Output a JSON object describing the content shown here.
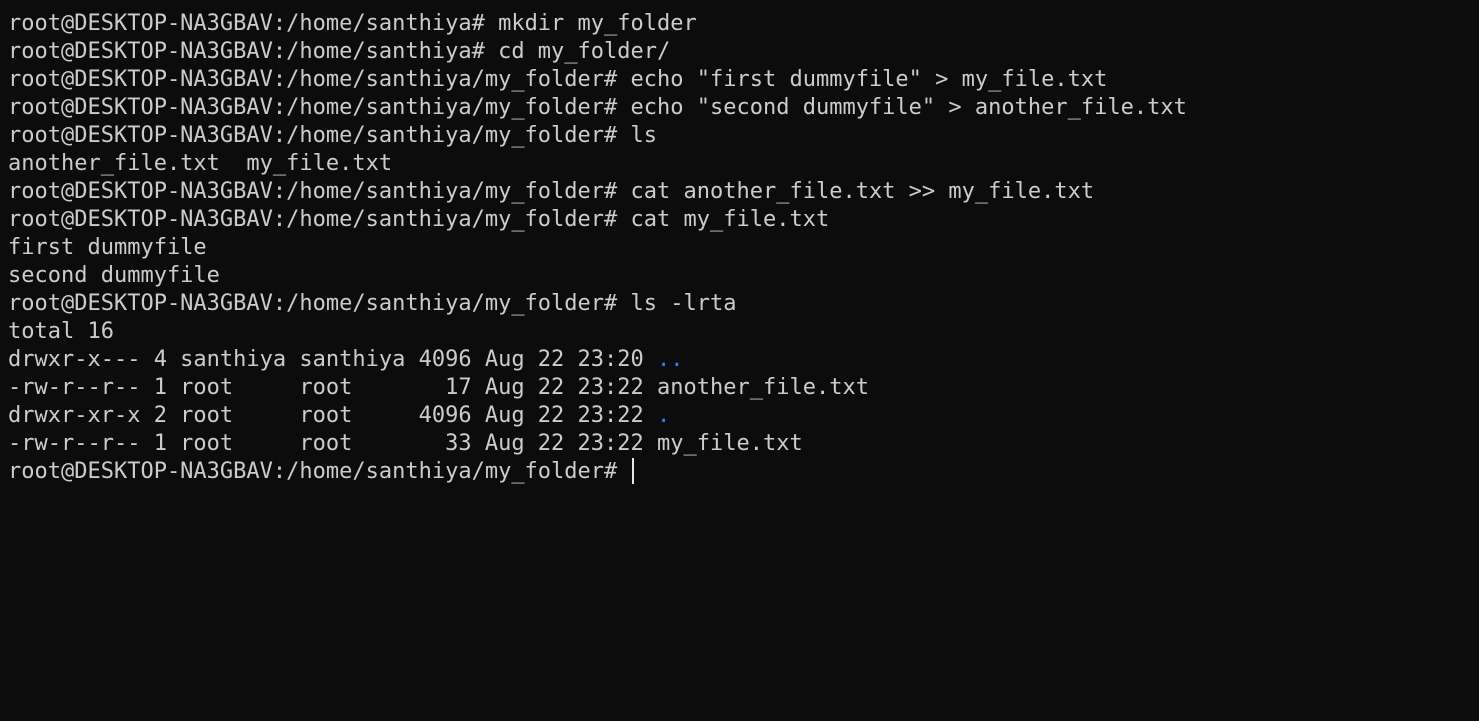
{
  "terminal": {
    "lines": [
      {
        "kind": "command",
        "prompt": "root@DESKTOP-NA3GBAV:/home/santhiya#",
        "command": " mkdir my_folder"
      },
      {
        "kind": "command",
        "prompt": "root@DESKTOP-NA3GBAV:/home/santhiya#",
        "command": " cd my_folder/"
      },
      {
        "kind": "command",
        "prompt": "root@DESKTOP-NA3GBAV:/home/santhiya/my_folder#",
        "command": " echo \"first dummyfile\" > my_file.txt"
      },
      {
        "kind": "command",
        "prompt": "root@DESKTOP-NA3GBAV:/home/santhiya/my_folder#",
        "command": " echo \"second dummyfile\" > another_file.txt"
      },
      {
        "kind": "command",
        "prompt": "root@DESKTOP-NA3GBAV:/home/santhiya/my_folder#",
        "command": " ls"
      },
      {
        "kind": "output",
        "text": "another_file.txt  my_file.txt"
      },
      {
        "kind": "command",
        "prompt": "root@DESKTOP-NA3GBAV:/home/santhiya/my_folder#",
        "command": " cat another_file.txt >> my_file.txt"
      },
      {
        "kind": "command",
        "prompt": "root@DESKTOP-NA3GBAV:/home/santhiya/my_folder#",
        "command": " cat my_file.txt"
      },
      {
        "kind": "output",
        "text": "first dummyfile"
      },
      {
        "kind": "output",
        "text": "second dummyfile"
      },
      {
        "kind": "command",
        "prompt": "root@DESKTOP-NA3GBAV:/home/santhiya/my_folder#",
        "command": " ls -lrta"
      },
      {
        "kind": "output",
        "text": "total 16"
      },
      {
        "kind": "listing",
        "prefix": "drwxr-x--- 4 santhiya santhiya 4096 Aug 22 23:20 ",
        "name": "..",
        "is_dir": true
      },
      {
        "kind": "listing",
        "prefix": "-rw-r--r-- 1 root     root       17 Aug 22 23:22 ",
        "name": "another_file.txt",
        "is_dir": false
      },
      {
        "kind": "listing",
        "prefix": "drwxr-xr-x 2 root     root     4096 Aug 22 23:22 ",
        "name": ".",
        "is_dir": true
      },
      {
        "kind": "listing",
        "prefix": "-rw-r--r-- 1 root     root       33 Aug 22 23:22 ",
        "name": "my_file.txt",
        "is_dir": false
      },
      {
        "kind": "active",
        "prompt": "root@DESKTOP-NA3GBAV:/home/santhiya/my_folder#",
        "command": " "
      }
    ]
  },
  "colors": {
    "background": "#0c0c0c",
    "foreground": "#cccccc",
    "directory": "#3b78ff",
    "cursor": "#e6e6e6"
  }
}
